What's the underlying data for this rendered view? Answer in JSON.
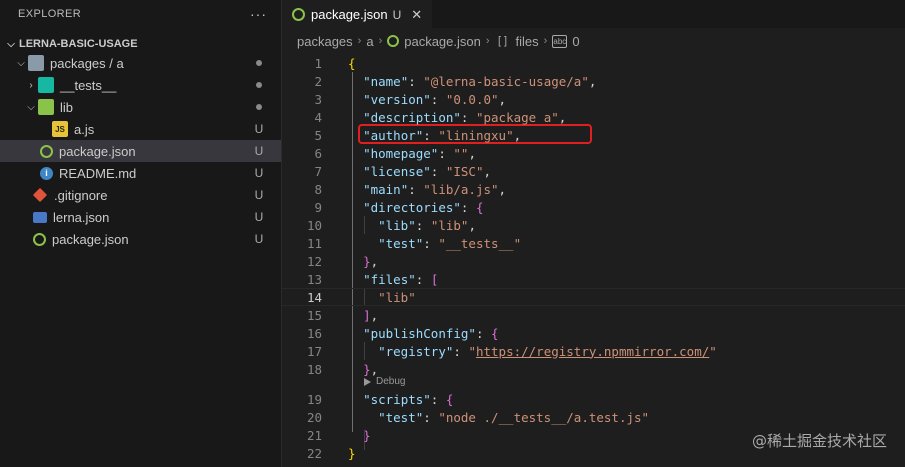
{
  "explorer": {
    "header": "EXPLORER",
    "more": "···",
    "project": "LERNA-BASIC-USAGE",
    "items": [
      {
        "label": "packages / a",
        "badge": ""
      },
      {
        "label": "__tests__",
        "badge": ""
      },
      {
        "label": "lib",
        "badge": ""
      },
      {
        "label": "a.js",
        "badge": "U"
      },
      {
        "label": "package.json",
        "badge": "U"
      },
      {
        "label": "README.md",
        "badge": "U"
      },
      {
        "label": ".gitignore",
        "badge": "U"
      },
      {
        "label": "lerna.json",
        "badge": "U"
      },
      {
        "label": "package.json",
        "badge": "U"
      }
    ]
  },
  "tab": {
    "label": "package.json",
    "status": "U",
    "close": "✕"
  },
  "breadcrumb": [
    "packages",
    "a",
    "package.json",
    "files",
    "0"
  ],
  "breadcrumb_icons": {
    "array": "[ ]",
    "string": "abc"
  },
  "codelens": "Debug",
  "watermark": "@稀土掘金技术社区",
  "lines": [
    {
      "n": "1",
      "tokens": [
        [
          "{",
          "b1"
        ]
      ]
    },
    {
      "n": "2",
      "tokens": [
        [
          "  ",
          "p"
        ],
        [
          "\"name\"",
          "k"
        ],
        [
          ": ",
          "p"
        ],
        [
          "\"@lerna-basic-usage/a\"",
          "s"
        ],
        [
          ",",
          "p"
        ]
      ]
    },
    {
      "n": "3",
      "tokens": [
        [
          "  ",
          "p"
        ],
        [
          "\"version\"",
          "k"
        ],
        [
          ": ",
          "p"
        ],
        [
          "\"0.0.0\"",
          "s"
        ],
        [
          ",",
          "p"
        ]
      ]
    },
    {
      "n": "4",
      "tokens": [
        [
          "  ",
          "p"
        ],
        [
          "\"description\"",
          "k"
        ],
        [
          ": ",
          "p"
        ],
        [
          "\"package a\"",
          "s"
        ],
        [
          ",",
          "p"
        ]
      ]
    },
    {
      "n": "5",
      "tokens": [
        [
          "  ",
          "p"
        ],
        [
          "\"author\"",
          "k"
        ],
        [
          ": ",
          "p"
        ],
        [
          "\"liningxu\"",
          "s"
        ],
        [
          ",",
          "p"
        ]
      ]
    },
    {
      "n": "6",
      "tokens": [
        [
          "  ",
          "p"
        ],
        [
          "\"homepage\"",
          "k"
        ],
        [
          ": ",
          "p"
        ],
        [
          "\"\"",
          "s"
        ],
        [
          ",",
          "p"
        ]
      ]
    },
    {
      "n": "7",
      "tokens": [
        [
          "  ",
          "p"
        ],
        [
          "\"license\"",
          "k"
        ],
        [
          ": ",
          "p"
        ],
        [
          "\"ISC\"",
          "s"
        ],
        [
          ",",
          "p"
        ]
      ]
    },
    {
      "n": "8",
      "tokens": [
        [
          "  ",
          "p"
        ],
        [
          "\"main\"",
          "k"
        ],
        [
          ": ",
          "p"
        ],
        [
          "\"lib/a.js\"",
          "s"
        ],
        [
          ",",
          "p"
        ]
      ]
    },
    {
      "n": "9",
      "tokens": [
        [
          "  ",
          "p"
        ],
        [
          "\"directories\"",
          "k"
        ],
        [
          ": ",
          "p"
        ],
        [
          "{",
          "b2"
        ]
      ]
    },
    {
      "n": "10",
      "tokens": [
        [
          "    ",
          "p"
        ],
        [
          "\"lib\"",
          "k"
        ],
        [
          ": ",
          "p"
        ],
        [
          "\"lib\"",
          "s"
        ],
        [
          ",",
          "p"
        ]
      ]
    },
    {
      "n": "11",
      "tokens": [
        [
          "    ",
          "p"
        ],
        [
          "\"test\"",
          "k"
        ],
        [
          ": ",
          "p"
        ],
        [
          "\"__tests__\"",
          "s"
        ]
      ]
    },
    {
      "n": "12",
      "tokens": [
        [
          "  ",
          "p"
        ],
        [
          "}",
          "b2"
        ],
        [
          ",",
          "p"
        ]
      ]
    },
    {
      "n": "13",
      "tokens": [
        [
          "  ",
          "p"
        ],
        [
          "\"files\"",
          "k"
        ],
        [
          ": ",
          "p"
        ],
        [
          "[",
          "b2"
        ]
      ]
    },
    {
      "n": "14",
      "tokens": [
        [
          "    ",
          "p"
        ],
        [
          "\"lib\"",
          "s"
        ]
      ]
    },
    {
      "n": "15",
      "tokens": [
        [
          "  ",
          "p"
        ],
        [
          "]",
          "b2"
        ],
        [
          ",",
          "p"
        ]
      ]
    },
    {
      "n": "16",
      "tokens": [
        [
          "  ",
          "p"
        ],
        [
          "\"publishConfig\"",
          "k"
        ],
        [
          ": ",
          "p"
        ],
        [
          "{",
          "b2"
        ]
      ]
    },
    {
      "n": "17",
      "tokens": [
        [
          "    ",
          "p"
        ],
        [
          "\"registry\"",
          "k"
        ],
        [
          ": ",
          "p"
        ],
        [
          "\"",
          "s"
        ],
        [
          "https://registry.npmmirror.com/",
          "s link"
        ],
        [
          "\"",
          "s"
        ]
      ]
    },
    {
      "n": "18",
      "tokens": [
        [
          "  ",
          "p"
        ],
        [
          "}",
          "b2"
        ],
        [
          ",",
          "p"
        ]
      ]
    },
    {
      "n": "19",
      "tokens": [
        [
          "  ",
          "p"
        ],
        [
          "\"scripts\"",
          "k"
        ],
        [
          ": ",
          "p"
        ],
        [
          "{",
          "b2"
        ]
      ]
    },
    {
      "n": "20",
      "tokens": [
        [
          "    ",
          "p"
        ],
        [
          "\"test\"",
          "k"
        ],
        [
          ": ",
          "p"
        ],
        [
          "\"node ./__tests__/a.test.js\"",
          "s"
        ]
      ]
    },
    {
      "n": "21",
      "tokens": [
        [
          "  ",
          "p"
        ],
        [
          "}",
          "b2"
        ]
      ]
    },
    {
      "n": "22",
      "tokens": [
        [
          "}",
          "b1"
        ]
      ]
    }
  ],
  "current_line": "14",
  "colors": {
    "key": "#9cdcfe",
    "string": "#ce9178",
    "bracket1": "#ffd700",
    "bracket2": "#da70d6",
    "highlight": "#e02020"
  }
}
